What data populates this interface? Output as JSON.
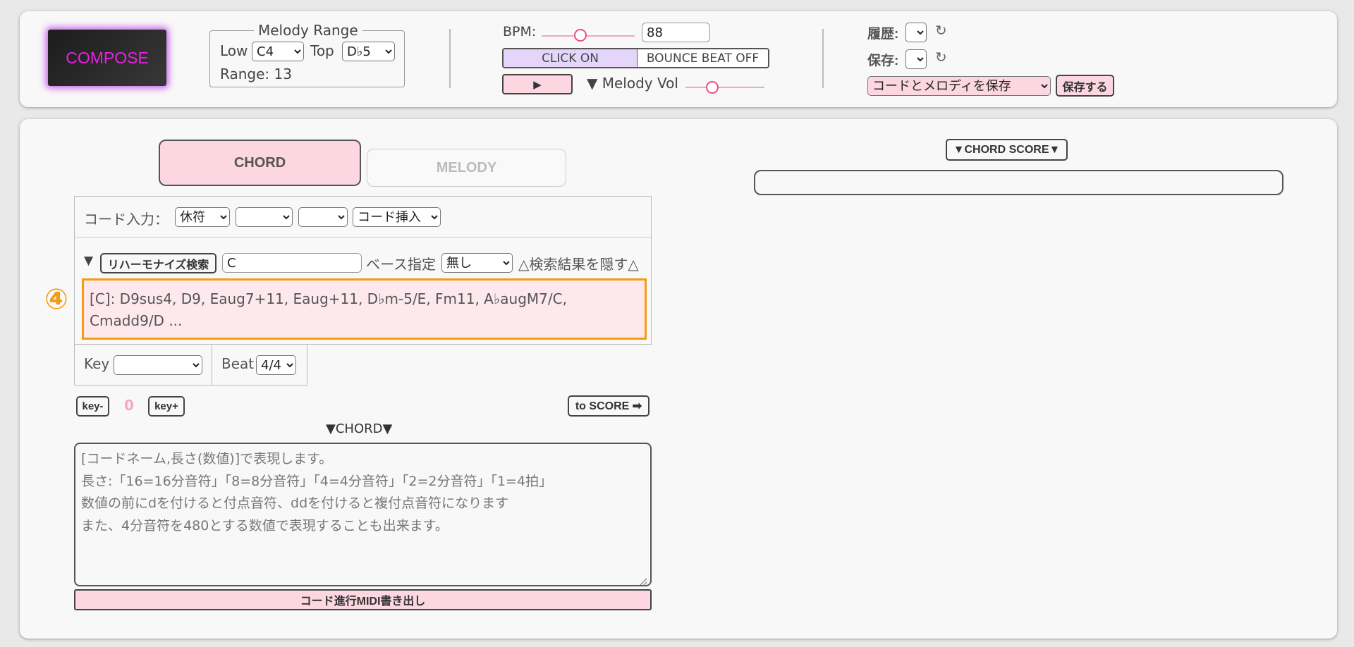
{
  "top": {
    "compose_label": "COMPOSE",
    "melody_range": {
      "legend": "Melody Range",
      "low_label": "Low",
      "low_value": "C4",
      "top_label": "Top",
      "top_value": "D♭5",
      "range_text": "Range: 13"
    },
    "bpm_label": "BPM:",
    "bpm_value": "88",
    "click_on_label": "CLICK ON",
    "bounce_label": "BOUNCE BEAT OFF",
    "play_label": "▶",
    "melody_vol_label": "▼ Melody Vol",
    "history_label": "履歴:",
    "save_label": "保存:",
    "refresh_glyph": "↻",
    "save_option": "コードとメロディを保存",
    "save_button": "保存する"
  },
  "tabs": {
    "chord": "CHORD",
    "melody": "MELODY"
  },
  "chord_input": {
    "label": "コード入力：",
    "select1": "休符",
    "select2": "",
    "select3": "",
    "select4": "コード挿入"
  },
  "reharm": {
    "toggle": "▼",
    "button": "リハーモナイズ検索",
    "input_value": "C",
    "bass_label": "ベース指定",
    "bass_value": "無し",
    "hide_label": "△検索結果を隠す△",
    "result_line1": "[C]: D9sus4, D9, Eaug7+11, Eaug+11, D♭m-5/E, Fm11, A♭augM7/C,",
    "result_line2": "Cmadd9/D ...",
    "marker": "④"
  },
  "key_beat": {
    "key_label": "Key",
    "key_value": "",
    "beat_label": "Beat",
    "beat_value": "4/4"
  },
  "transpose": {
    "minus": "key-",
    "value": "0",
    "plus": "key+",
    "to_score": "to SCORE ➡"
  },
  "chord_section_label": "▼CHORD▼",
  "textarea_lines": [
    "[コードネーム,長さ(数値)]で表現します。",
    "長さ:「16=16分音符」「8=8分音符」「4=4分音符」「2=2分音符」「1=4拍」",
    "数値の前にdを付けると付点音符、ddを付けると複付点音符になります",
    "また、4分音符を480とする数値で表現することも出来ます。"
  ],
  "midi_button": "コード進行MIDI書き出し",
  "score": {
    "button": "▼CHORD SCORE▼"
  },
  "colors": {
    "accent_pink": "#fcd7e1",
    "compose_text": "#ee1ee6",
    "highlight_orange": "#f39c12",
    "click_on_bg": "#e6d5fb"
  }
}
